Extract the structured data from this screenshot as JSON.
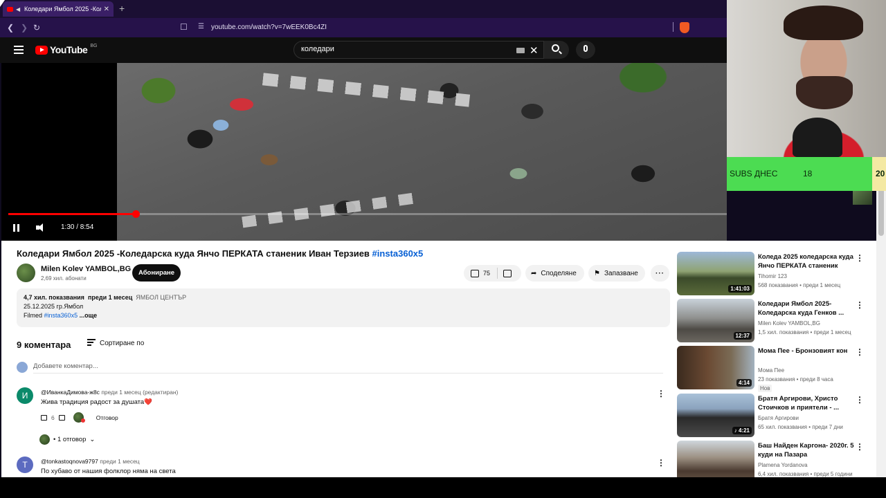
{
  "browser": {
    "tab_title": "Коледари Ямбол 2025 -Коле",
    "new_tab": "+",
    "url": "youtube.com/watch?v=7wEEK0Bc4ZI"
  },
  "header": {
    "logo_text": "YouTube",
    "region": "BG",
    "search_value": "коледари"
  },
  "player": {
    "time": "1:30 / 8:54",
    "progress": 0.169,
    "accent": "#ff0000"
  },
  "video": {
    "title": "Коледари Ямбол 2025 -Коледарска куда Янчо ПЕРКАТА станеник Иван Терзиев",
    "title_tag": "#insta360x5",
    "channel": "Milen Kolev YAMBOL,BG",
    "subscribers": "2,69 хил. абонати",
    "subscribe_label": "Абониране",
    "likes": "75",
    "share_label": "Споделяне",
    "save_label": "Запазване",
    "views": "4,7 хил. показвания",
    "date": "преди 1 месец",
    "location": "ЯМБОЛ ЦЕНТЪР",
    "desc_line1": "25.12.2025 гр.Ямбол",
    "desc_filmed": "Filmed",
    "desc_tag": "#insta360x5",
    "desc_more": "...още"
  },
  "comments": {
    "count_label": "9 коментара",
    "sort_label": "Сортиране по",
    "add_placeholder": "Добавете коментар...",
    "items": [
      {
        "avatar_letter": "И",
        "author": "@ИванкаДимова-ж8с",
        "meta": "преди 1 месец (редактиран)",
        "text": "Жива традиция радост за душата",
        "heart": "❤️",
        "likes": "6",
        "reply_label": "Отговор",
        "avatar_color": "#0b8a6a"
      },
      {
        "avatar_letter": "T",
        "author": "@tonkastoqnova9797",
        "meta": "преди 1 месец",
        "text": "По хубаво от нашия фолклор няма на света",
        "avatar_color": "#5c6bc0"
      }
    ],
    "replies_label": "• 1 отговор"
  },
  "recommendations": [
    {
      "title": "Коледа 2025 коледарска куда Янчо ПЕРКАТА станеник Ива...",
      "channel": "Tihomir 123",
      "stats": "568 показвания • преди 1 месец",
      "duration": "1:41:03"
    },
    {
      "title": "Коледари Ямбол 2025- Коледарска куда Генков ...",
      "channel": "Milen Kolev YAMBOL,BG",
      "stats": "1,5 хил. показвания • преди 1 месец",
      "duration": "12:37"
    },
    {
      "title": "Мома Пее - Бронзовият кон",
      "channel": "Мома Пее",
      "stats": "23 показвания • преди 8 часа",
      "duration": "4:14",
      "badge": "Нов"
    },
    {
      "title": "Братя Аргирови, Христо Стоичков и приятели - ...",
      "channel": "Братя Аргирови",
      "stats": "65 хил. показвания • преди 7 дни",
      "duration": "4:21"
    },
    {
      "title": "Баш Найден Каргона- 2020г. 5 куди на Пазара",
      "channel": "Plamena Yordanova",
      "stats": "6,4 хил. показвания • преди 5 години",
      "duration": ""
    }
  ],
  "overlay": {
    "subs_label": "SUBS ДНЕС",
    "subs_today": "18",
    "subs_goal": "20"
  }
}
